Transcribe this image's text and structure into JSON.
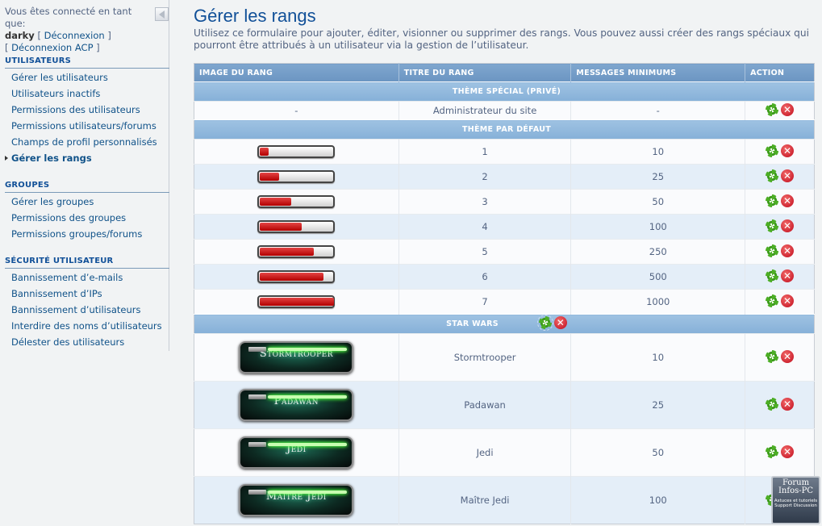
{
  "sidebar": {
    "login_prefix": "Vous êtes connecté en tant que:",
    "username": "darky",
    "logout": "Déconnexion",
    "logout_acp": "Déconnexion ACP",
    "sections": [
      {
        "title": "UTILISATEURS",
        "items": [
          "Gérer les utilisateurs",
          "Utilisateurs inactifs",
          "Permissions des utilisateurs",
          "Permissions utilisateurs/forums",
          "Champs de profil personnalisés",
          "Gérer les rangs"
        ]
      },
      {
        "title": "GROUPES",
        "items": [
          "Gérer les groupes",
          "Permissions des groupes",
          "Permissions groupes/forums"
        ]
      },
      {
        "title": "SÉCURITÉ UTILISATEUR",
        "items": [
          "Bannissement d’e-mails",
          "Bannissement d’IPs",
          "Bannissement d’utilisateurs",
          "Interdire des noms d’utilisateurs",
          "Délester des utilisateurs"
        ]
      }
    ]
  },
  "main": {
    "title": "Gérer les rangs",
    "intro": "Utilisez ce formulaire pour ajouter, éditer, visionner ou supprimer des rangs. Vous pouvez aussi créer des rangs spéciaux qui pourront être attribués à un utilisateur via la gestion de l’utilisateur.",
    "columns": [
      "IMAGE DU RANG",
      "TITRE DU RANG",
      "MESSAGES MINIMUMS",
      "ACTION"
    ],
    "categories": {
      "special": "THÈME SPÉCIAL (PRIVÉ)",
      "default": "THÈME PAR DÉFAUT",
      "starwars": "STAR WARS"
    },
    "special_row": {
      "image": "-",
      "title": "Administrateur du site",
      "min": "-"
    },
    "default_rows": [
      {
        "title": "1",
        "min": "10",
        "fill": 0.12
      },
      {
        "title": "2",
        "min": "25",
        "fill": 0.26
      },
      {
        "title": "3",
        "min": "50",
        "fill": 0.42
      },
      {
        "title": "4",
        "min": "100",
        "fill": 0.56
      },
      {
        "title": "5",
        "min": "250",
        "fill": 0.72
      },
      {
        "title": "6",
        "min": "500",
        "fill": 0.86
      },
      {
        "title": "7",
        "min": "1000",
        "fill": 1.0
      }
    ],
    "starwars_rows": [
      {
        "image_text": "Stormtrooper",
        "title": "Stormtrooper",
        "min": "10"
      },
      {
        "image_text": "Padawan",
        "title": "Padawan",
        "min": "25"
      },
      {
        "image_text": "Jedi",
        "title": "Jedi",
        "min": "50"
      },
      {
        "image_text": "Maître Jedi",
        "title": "Maître Jedi",
        "min": "100"
      }
    ],
    "delete_glyph": "✕"
  },
  "watermark": {
    "line1": "Forum",
    "line2": "Infos-PC",
    "line3": "Astuces et tutoriels Support Discussion"
  },
  "colors": {
    "link": "#105289",
    "header_blue": "#6b95c2",
    "accent_green": "#4cae25",
    "delete_red": "#c00a1b"
  }
}
